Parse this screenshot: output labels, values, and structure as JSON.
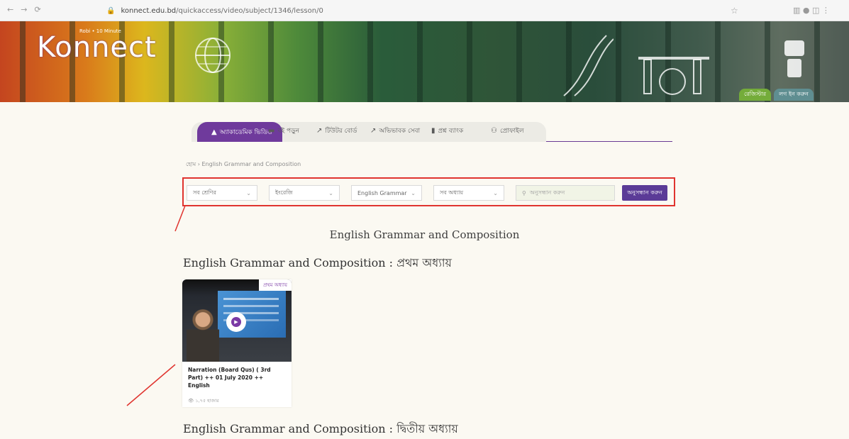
{
  "browser": {
    "nav_back": "←",
    "nav_forward": "→",
    "nav_reload": "⟳",
    "url_domain": "konnect.edu.bd",
    "url_path": "/quickaccess/video/subject/1346/lesson/0",
    "star": "☆",
    "extensions": "▥ ● ◫ ⋮"
  },
  "banner": {
    "logo": "Konnect",
    "logo_tag": "Robi • 10 Minute",
    "buttons": [
      "রেজিস্টার",
      "লগ ইন করুন"
    ]
  },
  "tabs": [
    {
      "icon": "book-icon",
      "glyph": "▲",
      "label": "অ্যাকাডেমিক ভিডিও"
    },
    {
      "icon": "book-icon",
      "glyph": "▬",
      "label": "বই পড়ুন"
    },
    {
      "icon": "chart-icon",
      "glyph": "↗",
      "label": "টিউটর বোর্ড"
    },
    {
      "icon": "chart-icon",
      "glyph": "↗",
      "label": "অভিভাবক সেবা"
    },
    {
      "icon": "book-icon",
      "glyph": "▮",
      "label": "প্রশ্ন ব্যাংক"
    },
    {
      "icon": "user-icon",
      "glyph": "⚇",
      "label": "প্রোফাইল"
    }
  ],
  "breadcrumb": "হোম  ›  English Grammar and Composition",
  "filters": {
    "class": "সব শ্রেণির",
    "subject": "ইংরেজি",
    "book": "English Grammar",
    "chapter": "সব অধ্যায়",
    "search_placeholder": "অনুসন্ধান করুন",
    "search_button": "অনুসন্ধান করুন"
  },
  "page_title": "English Grammar and Composition",
  "sections": [
    {
      "heading": "English Grammar and Composition : প্রথম অধ্যায়"
    },
    {
      "heading": "English Grammar and Composition : দ্বিতীয় অধ্যায়"
    }
  ],
  "card": {
    "badge": "প্রথম অধ্যায়",
    "title": "Narration (Board Qus) ( 3rd Part) ++ 01 July 2020 ++ English",
    "meta": "👁 ১,৭৫ হাজার"
  },
  "colors": {
    "accent": "#6f3a9c",
    "annotation": "#e0342f",
    "background": "#fbf9f2"
  }
}
